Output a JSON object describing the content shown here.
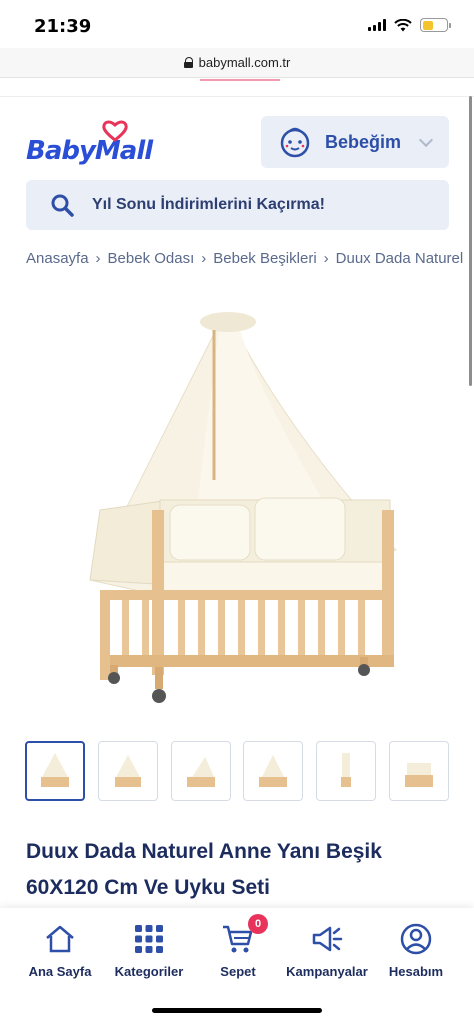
{
  "status_bar": {
    "time": "21:39"
  },
  "browser": {
    "url": "babymall.com.tr"
  },
  "header": {
    "logo_text": "BabyMall",
    "account_label": "Bebeğim"
  },
  "search": {
    "placeholder": "Yıl Sonu İndirimlerini Kaçırma!"
  },
  "breadcrumb": [
    "Anasayfa",
    "Bebek Odası",
    "Bebek Beşikleri",
    "Duux Dada Naturel"
  ],
  "breadcrumb_separator": "›",
  "product": {
    "title": "Duux Dada Naturel Anne Yanı Beşik 60X120 Cm Ve Uyku Seti",
    "thumbnail_count": 6,
    "active_thumbnail_index": 0
  },
  "bottom_nav": {
    "items": [
      {
        "label": "Ana Sayfa",
        "icon": "home-icon"
      },
      {
        "label": "Kategoriler",
        "icon": "grid-icon"
      },
      {
        "label": "Sepet",
        "icon": "cart-icon",
        "badge": "0"
      },
      {
        "label": "Kampanyalar",
        "icon": "megaphone-icon"
      },
      {
        "label": "Hesabım",
        "icon": "user-icon"
      }
    ]
  },
  "colors": {
    "brand_blue": "#2d4fa8",
    "navy_text": "#1d2c5e",
    "box_bg": "#eaeef7",
    "accent_pink": "#e8335b",
    "wood": "#e6c08f"
  }
}
